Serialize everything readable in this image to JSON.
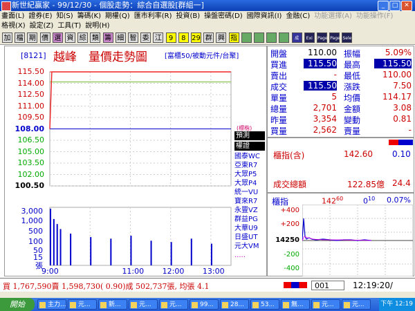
{
  "window": {
    "title": "新世紀贏家 - 99/12/30 - 個股走勢：綜合自選股[群組一]"
  },
  "menu": {
    "row1": [
      "畫面(L)",
      "證券(E)",
      "知(S)",
      "籌碼(K)",
      "期權(Q)",
      "匯市利率(R)",
      "投資(B)",
      "操盤密碼(D)",
      "國際資訊(I)",
      "金融(C)",
      "功能選擇(A)",
      "功能操作(F)"
    ],
    "row2": [
      "格視(X)",
      "設定(Z)",
      "工具(T)",
      "說明(H)"
    ]
  },
  "toolbar": {
    "buttons": [
      "加",
      "檔",
      "期",
      "價",
      "選",
      "資",
      "綜",
      "類",
      "籌",
      "細",
      "智",
      "委",
      "江",
      "9",
      "8",
      "29",
      "群",
      "興",
      "指",
      "",
      "",
      "",
      "",
      "成",
      "Exi",
      "Page",
      "Page",
      "Sele"
    ]
  },
  "header": {
    "code": "[8121]",
    "name": "越峰",
    "title": "量價走勢圖",
    "subtitle": "[富櫃50/被動元件/台聚]"
  },
  "chart_data": {
    "type": "line",
    "title": "量價走勢圖",
    "xlabel": "",
    "ylabel": "",
    "x_ticks": [
      "9:00",
      "11:00",
      "12:00",
      "13:00"
    ],
    "price_ticks": [
      "115.50",
      "114.00",
      "112.50",
      "111.00",
      "109.50",
      "108.00",
      "106.50",
      "105.00",
      "103.50",
      "102.00",
      "100.50"
    ],
    "ylim": [
      100.5,
      115.5
    ],
    "reference_price": 108.0,
    "price_series": [
      {
        "x": "9:00",
        "y": 108.0
      },
      {
        "x": "9:03",
        "y": 115.5
      },
      {
        "x": "9:05",
        "y": 115.5
      },
      {
        "x": "13:30",
        "y": 115.5
      }
    ],
    "volume_ticks": [
      "3,000",
      "1,000",
      "500",
      "100",
      "50",
      "15"
    ],
    "volume_unit": "張",
    "volume_bars": [
      {
        "x": "9:00",
        "v": 2500
      },
      {
        "x": "9:05",
        "v": 600
      },
      {
        "x": "9:10",
        "v": 300
      },
      {
        "x": "9:15",
        "v": 150
      },
      {
        "x": "9:30",
        "v": 80
      },
      {
        "x": "10:00",
        "v": 50
      },
      {
        "x": "10:30",
        "v": 40
      },
      {
        "x": "11:00",
        "v": 60
      },
      {
        "x": "11:30",
        "v": 30
      },
      {
        "x": "12:00",
        "v": 25
      },
      {
        "x": "12:30",
        "v": 40
      },
      {
        "x": "13:00",
        "v": 20
      }
    ]
  },
  "quotes": [
    {
      "l1": "開盤",
      "v1": "110.00",
      "l2": "振幅",
      "v2": "5.09%"
    },
    {
      "l1": "買進",
      "v1": "115.50",
      "l2": "最高",
      "v2": "115.50"
    },
    {
      "l1": "賣出",
      "v1": "-",
      "l2": "最低",
      "v2": "110.00"
    },
    {
      "l1": "成交",
      "v1": "115.50",
      "l2": "漲跌",
      "v2": "7.50"
    },
    {
      "l1": "單量",
      "v1": "5",
      "l2": "均價",
      "v2": "114.17"
    },
    {
      "l1": "總量",
      "v1": "2,701",
      "l2": "金額",
      "v2": "3.08"
    },
    {
      "l1": "昨量",
      "v1": "3,354",
      "l2": "變動",
      "v2": "0.81"
    },
    {
      "l1": "買量",
      "v1": "2,562",
      "l2": "賣量",
      "v2": "-"
    }
  ],
  "legend_small": "(標楷)",
  "side_list": {
    "header1": "預測",
    "header2": "權證",
    "items": [
      "國泰WC",
      "亞東R7",
      "大眾P5",
      "大眾P4",
      "統一VU",
      "寶來R7",
      "永豐VZ",
      "群益PG",
      "大華U9",
      "日盛UT",
      "元大VM",
      "....."
    ]
  },
  "index_panel": {
    "label": "櫃指(含)",
    "value": "142.60",
    "change": "0.10",
    "turnover_label": "成交總額",
    "turnover": "122.85億",
    "turnover_chg": "24.4"
  },
  "mini_chart": {
    "label": "櫃指",
    "price": "142",
    "price_sup": "60",
    "change": "0",
    "change_sup": "10",
    "pct": "0.07%",
    "ticks": [
      "+400",
      "+200",
      "14250",
      "-200",
      "-400"
    ]
  },
  "status": {
    "text": "買 1,767,590賣 1,598,730( 0.90)成 502,737張, 均張 4.1",
    "code": "001",
    "time": "12:19:20/"
  },
  "taskbar": {
    "start": "開始",
    "items": [
      "主力...",
      "元...",
      "新...",
      "元...",
      "元...",
      "99...",
      "28...",
      "53...",
      "無...",
      "元...",
      "元..."
    ],
    "clock": "下午 12:19"
  }
}
